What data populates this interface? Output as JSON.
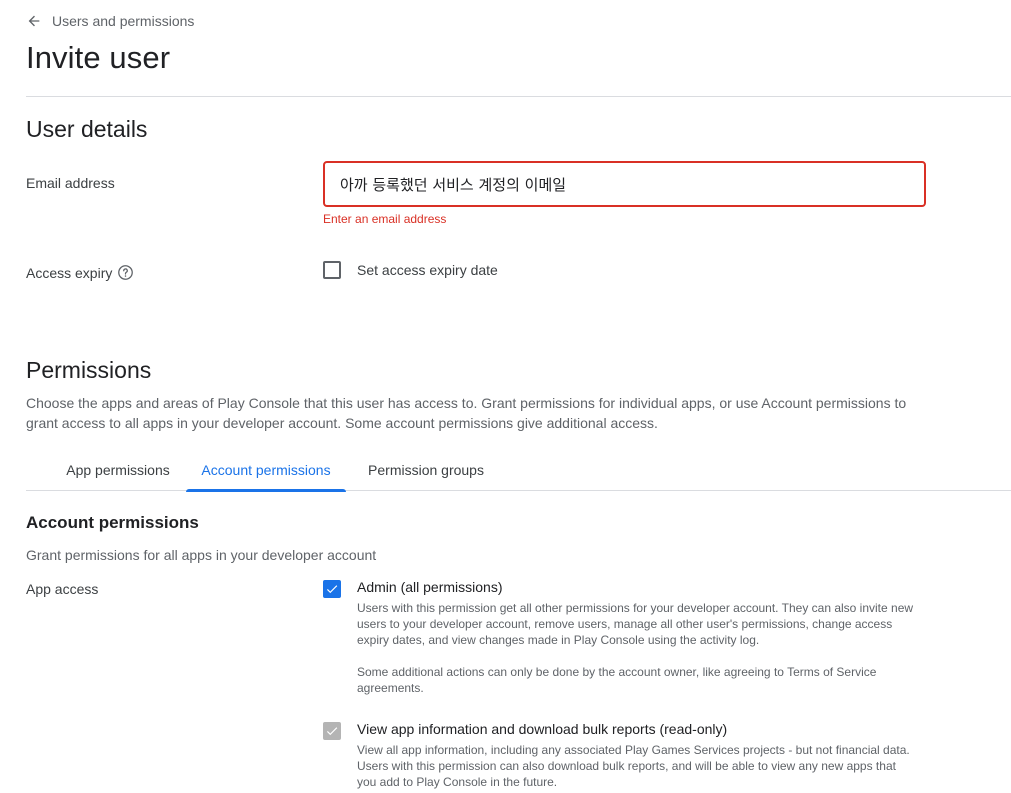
{
  "breadcrumb": {
    "label": "Users and permissions"
  },
  "page": {
    "title": "Invite user"
  },
  "user_details": {
    "title": "User details",
    "email": {
      "label": "Email address",
      "value": "아까 등록했던 서비스 계정의 이메일",
      "error": "Enter an email address"
    },
    "access_expiry": {
      "label": "Access expiry",
      "checkbox_label": "Set access expiry date",
      "checked": false
    }
  },
  "permissions": {
    "title": "Permissions",
    "description": "Choose the apps and areas of Play Console that this user has access to. Grant permissions for individual apps, or use Account permissions to grant access to all apps in your developer account. Some account permissions give additional access.",
    "tabs": [
      {
        "label": "App permissions",
        "active": false
      },
      {
        "label": "Account permissions",
        "active": true
      },
      {
        "label": "Permission groups",
        "active": false
      }
    ]
  },
  "account_permissions": {
    "title": "Account permissions",
    "description": "Grant permissions for all apps in your developer account",
    "group_label": "App access",
    "items": [
      {
        "label": "Admin (all permissions)",
        "checked": true,
        "disabled": false,
        "desc1": "Users with this permission get all other permissions for your developer account. They can also invite new users to your developer account, remove users, manage all other user's permissions, change access expiry dates, and view changes made in Play Console using the activity log.",
        "desc2": "Some additional actions can only be done by the account owner, like agreeing to Terms of Service agreements."
      },
      {
        "label": "View app information and download bulk reports (read-only)",
        "checked": true,
        "disabled": true,
        "desc1": "View all app information, including any associated Play Games Services projects - but not financial data. Users with this permission can also download bulk reports, and will be able to view any new apps that you add to Play Console in the future."
      }
    ]
  },
  "colors": {
    "accent": "#1a73e8",
    "error": "#d93025",
    "disabled": "#b4b4b4"
  },
  "icons": [
    "arrow-back-icon",
    "help-icon",
    "check-icon"
  ]
}
